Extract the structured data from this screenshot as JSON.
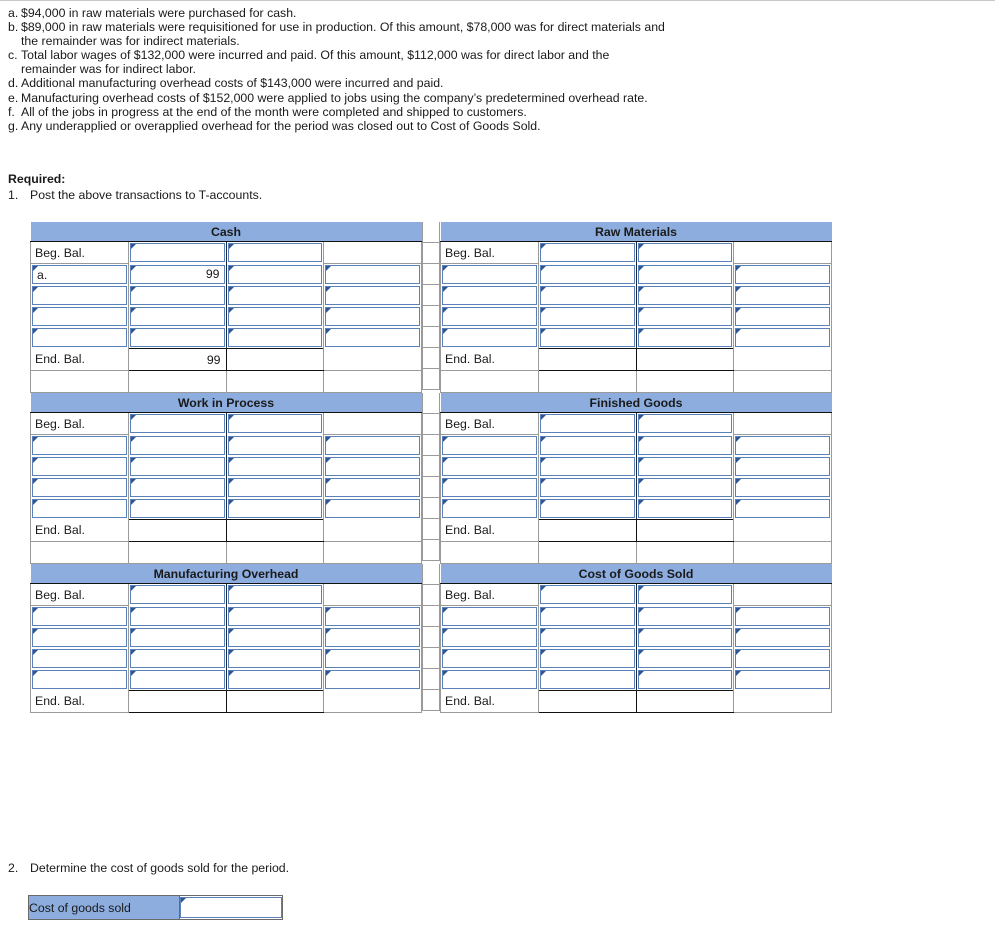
{
  "transactions": [
    {
      "letter": "a.",
      "text": "$94,000 in raw materials were purchased for cash."
    },
    {
      "letter": "b.",
      "text": "$89,000 in raw materials were requisitioned for use in production. Of this amount, $78,000 was for direct materials and the remainder was for indirect materials."
    },
    {
      "letter": "c.",
      "text": "Total labor wages of $132,000 were incurred and paid. Of this amount, $112,000 was for direct labor and the remainder was for indirect labor."
    },
    {
      "letter": "d.",
      "text": "Additional manufacturing overhead costs of $143,000 were incurred and paid."
    },
    {
      "letter": "e.",
      "text": "Manufacturing overhead costs of $152,000 were applied to jobs using the company’s predetermined overhead rate."
    },
    {
      "letter": "f.",
      "text": "All of the jobs in progress at the end of the month were completed and shipped to customers."
    },
    {
      "letter": "g.",
      "text": "Any underapplied or overapplied overhead for the period was closed out to Cost of Goods Sold."
    }
  ],
  "required": {
    "title": "Required:",
    "item1_num": "1.",
    "item1_text": "Post the above transactions to T-accounts."
  },
  "labels": {
    "beg_bal": "Beg. Bal.",
    "end_bal": "End. Bal."
  },
  "accounts": [
    {
      "title": "Cash",
      "rows": [
        {
          "label": "Beg. Bal.",
          "label_input": false,
          "debit": "",
          "credit": "",
          "extra_input": false
        },
        {
          "label": "a.",
          "label_input": true,
          "debit": "99",
          "credit": "",
          "extra_input": true
        },
        {
          "label": "",
          "label_input": true,
          "debit": "",
          "credit": "",
          "extra_input": true
        },
        {
          "label": "",
          "label_input": true,
          "debit": "",
          "credit": "",
          "extra_input": true
        },
        {
          "label": "",
          "label_input": true,
          "debit": "",
          "credit": "",
          "extra_input": true
        }
      ],
      "end_label": "End. Bal.",
      "end_debit": "99",
      "end_credit": "",
      "trailing_row": true
    },
    {
      "title": "Raw Materials",
      "rows": [
        {
          "label": "Beg. Bal.",
          "label_input": false,
          "debit": "",
          "credit": "",
          "extra_input": false
        },
        {
          "label": "",
          "label_input": true,
          "debit": "",
          "credit": "",
          "extra_input": true
        },
        {
          "label": "",
          "label_input": true,
          "debit": "",
          "credit": "",
          "extra_input": true
        },
        {
          "label": "",
          "label_input": true,
          "debit": "",
          "credit": "",
          "extra_input": true
        },
        {
          "label": "",
          "label_input": true,
          "debit": "",
          "credit": "",
          "extra_input": true
        }
      ],
      "end_label": "End. Bal.",
      "end_debit": "",
      "end_credit": "",
      "trailing_row": true
    },
    {
      "title": "Work in Process",
      "rows": [
        {
          "label": "Beg. Bal.",
          "label_input": false,
          "debit": "",
          "credit": "",
          "extra_input": false
        },
        {
          "label": "",
          "label_input": true,
          "debit": "",
          "credit": "",
          "extra_input": true
        },
        {
          "label": "",
          "label_input": true,
          "debit": "",
          "credit": "",
          "extra_input": true
        },
        {
          "label": "",
          "label_input": true,
          "debit": "",
          "credit": "",
          "extra_input": true
        },
        {
          "label": "",
          "label_input": true,
          "debit": "",
          "credit": "",
          "extra_input": true
        }
      ],
      "end_label": "End. Bal.",
      "end_debit": "",
      "end_credit": "",
      "trailing_row": true
    },
    {
      "title": "Finished Goods",
      "rows": [
        {
          "label": "Beg. Bal.",
          "label_input": false,
          "debit": "",
          "credit": "",
          "extra_input": false
        },
        {
          "label": "",
          "label_input": true,
          "debit": "",
          "credit": "",
          "extra_input": true
        },
        {
          "label": "",
          "label_input": true,
          "debit": "",
          "credit": "",
          "extra_input": true
        },
        {
          "label": "",
          "label_input": true,
          "debit": "",
          "credit": "",
          "extra_input": true
        },
        {
          "label": "",
          "label_input": true,
          "debit": "",
          "credit": "",
          "extra_input": true
        }
      ],
      "end_label": "End. Bal.",
      "end_debit": "",
      "end_credit": "",
      "trailing_row": true
    },
    {
      "title": "Manufacturing Overhead",
      "rows": [
        {
          "label": "Beg. Bal.",
          "label_input": false,
          "debit": "",
          "credit": "",
          "extra_input": false
        },
        {
          "label": "",
          "label_input": true,
          "debit": "",
          "credit": "",
          "extra_input": true
        },
        {
          "label": "",
          "label_input": true,
          "debit": "",
          "credit": "",
          "extra_input": true
        },
        {
          "label": "",
          "label_input": true,
          "debit": "",
          "credit": "",
          "extra_input": true
        },
        {
          "label": "",
          "label_input": true,
          "debit": "",
          "credit": "",
          "extra_input": true
        }
      ],
      "end_label": "End. Bal.",
      "end_debit": "",
      "end_credit": "",
      "trailing_row": false
    },
    {
      "title": "Cost of Goods Sold",
      "rows": [
        {
          "label": "Beg. Bal.",
          "label_input": false,
          "debit": "",
          "credit": "",
          "extra_input": false
        },
        {
          "label": "",
          "label_input": true,
          "debit": "",
          "credit": "",
          "extra_input": true
        },
        {
          "label": "",
          "label_input": true,
          "debit": "",
          "credit": "",
          "extra_input": true
        },
        {
          "label": "",
          "label_input": true,
          "debit": "",
          "credit": "",
          "extra_input": true
        },
        {
          "label": "",
          "label_input": true,
          "debit": "",
          "credit": "",
          "extra_input": true
        }
      ],
      "end_label": "End. Bal.",
      "end_debit": "",
      "end_credit": "",
      "trailing_row": false
    }
  ],
  "question2": {
    "num": "2.",
    "text": "Determine the cost of goods sold for the period.",
    "cogs_label": "Cost of goods sold",
    "cogs_value": ""
  },
  "colors": {
    "header_blue": "#8cadde",
    "input_border_blue": "#5b82b8",
    "marker_blue": "#2f5596",
    "grid_gray": "#9a9a9a",
    "rule_black": "#111111"
  }
}
